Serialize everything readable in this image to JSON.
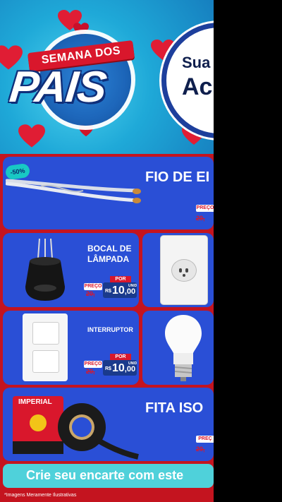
{
  "hero": {
    "event_line1": "SEMANA DOS",
    "event_line2": "PAIS",
    "badge_line1": "Sua",
    "badge_line2": "Ac"
  },
  "products": {
    "cable": {
      "title": "FIO DE EI",
      "discount": "-50%",
      "preco_label": "PREÇO",
      "old_price": "20,"
    },
    "socket": {
      "title_l1": "BOCAL DE",
      "title_l2": "LÂMPADA",
      "por_label": "POR",
      "preco_label": "PREÇO",
      "old_price": "20,",
      "currency": "R$",
      "price_int": "10",
      "price_cents": ",00",
      "unit": "UNID"
    },
    "switch": {
      "title": "INTERRUPTOR",
      "por_label": "POR",
      "preco_label": "PREÇO",
      "old_price": "20,",
      "currency": "R$",
      "price_int": "10",
      "price_cents": ",00",
      "unit": "UNID"
    },
    "tape": {
      "title": "FITA ISO",
      "preco_label": "PREÇ",
      "old_price": "20,",
      "brand": "IMPERIAL"
    }
  },
  "cta": {
    "text": "Crie seu encarte com este"
  },
  "footer": {
    "disclaimer": "*Imagens Meramente Ilustrativas"
  },
  "colors": {
    "background_red": "#c4141f",
    "card_blue": "#2a4fd6",
    "price_navy": "#1a3a8c",
    "accent_cyan": "#4fd1da",
    "hero_sky": "#1fa9d8"
  }
}
